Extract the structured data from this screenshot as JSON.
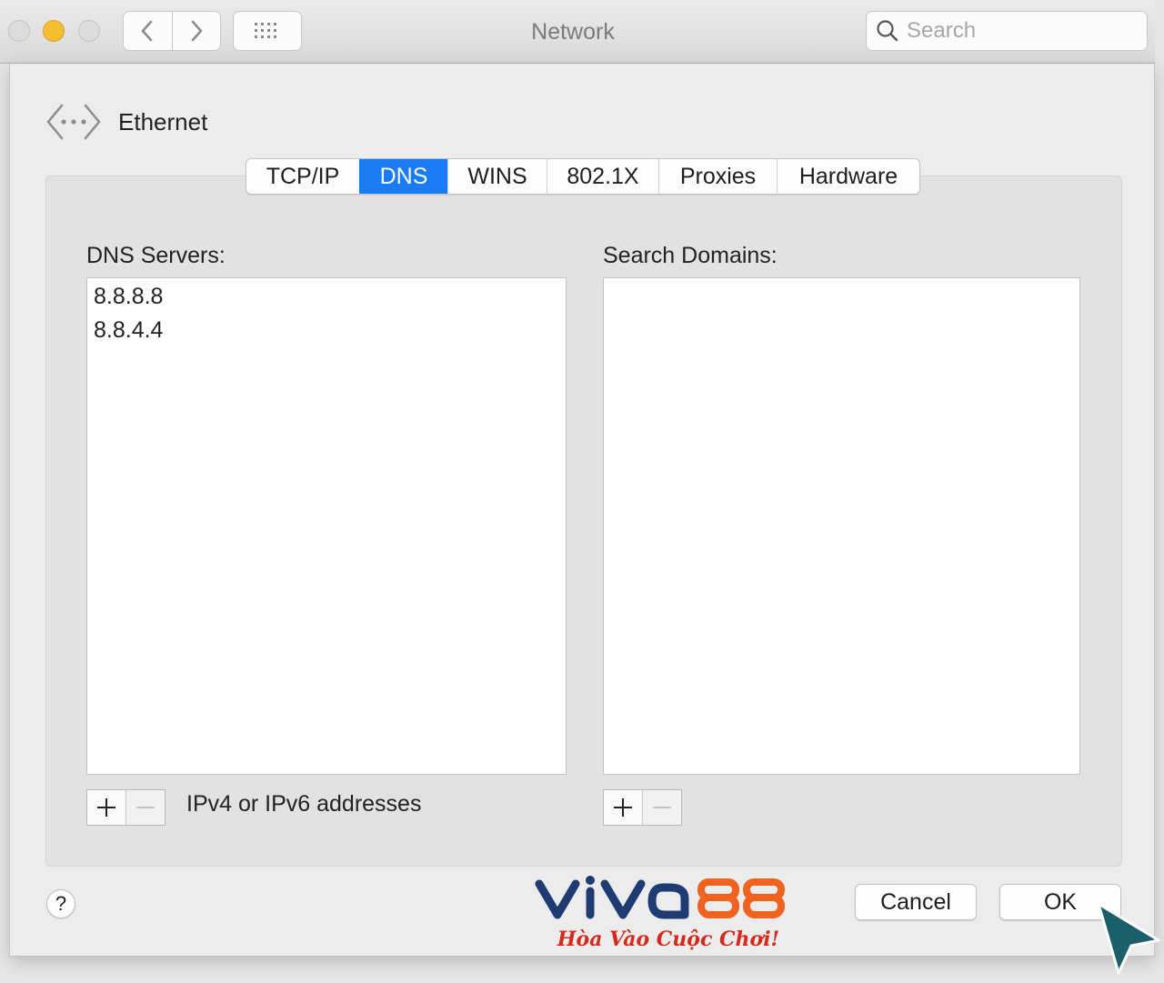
{
  "window": {
    "title": "Network"
  },
  "toolbar": {
    "back_icon": "chevron-left-icon",
    "forward_icon": "chevron-right-icon",
    "grid_icon": "grid-icon",
    "search_placeholder": "Search"
  },
  "interface": {
    "label": "Ethernet",
    "icon": "ethernet-icon"
  },
  "tabs": [
    {
      "label": "TCP/IP",
      "active": false
    },
    {
      "label": "DNS",
      "active": true
    },
    {
      "label": "WINS",
      "active": false
    },
    {
      "label": "802.1X",
      "active": false
    },
    {
      "label": "Proxies",
      "active": false
    },
    {
      "label": "Hardware",
      "active": false
    }
  ],
  "dns_servers": {
    "label": "DNS Servers:",
    "items": [
      "8.8.8.8",
      "8.8.4.4"
    ],
    "hint": "IPv4 or IPv6 addresses"
  },
  "search_domains": {
    "label": "Search Domains:",
    "items": []
  },
  "buttons": {
    "help": "?",
    "cancel": "Cancel",
    "ok": "OK",
    "add": "+",
    "remove": "−"
  },
  "watermark": {
    "brand": "VIVA88",
    "tagline": "Hòa Vào Cuộc Chơi!"
  },
  "colors": {
    "accent": "#1a7cf5",
    "traffic_min": "#f5bd30",
    "logo_blue": "#1f3b73",
    "logo_orange": "#f0621f",
    "logo_red": "#d42a1e",
    "cursor": "#1b5f6b"
  }
}
